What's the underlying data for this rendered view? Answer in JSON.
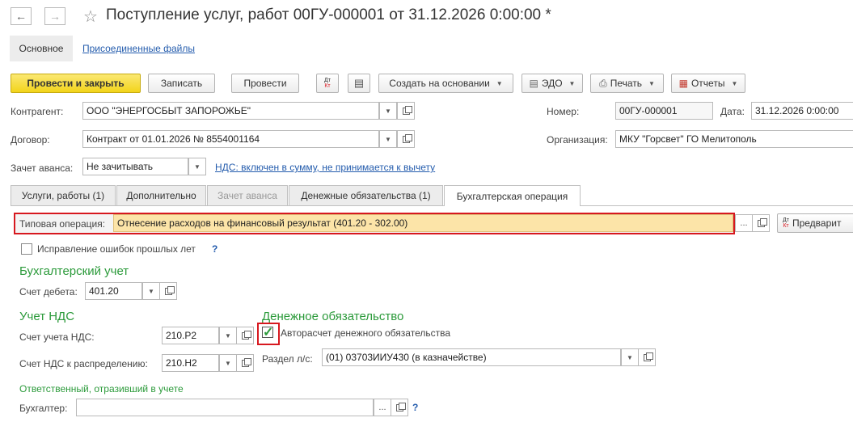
{
  "window": {
    "title": "Поступление услуг, работ 00ГУ-000001 от 31.12.2026 0:00:00 *"
  },
  "nav": {
    "back_icon": "arrow-left-icon",
    "forward_icon": "arrow-right-icon",
    "favorite_icon": "star-icon"
  },
  "sections": {
    "main": "Основное",
    "files": "Присоединенные файлы"
  },
  "toolbar": {
    "post_close": "Провести и закрыть",
    "save": "Записать",
    "post": "Провести",
    "dt_kt_icon": "dt-kt-icon",
    "report_icon": "list-icon",
    "create_based": "Создать на основании",
    "edo": "ЭДО",
    "print": "Печать",
    "reports": "Отчеты"
  },
  "header": {
    "counterparty_label": "Контрагент:",
    "counterparty_value": "ООО \"ЭНЕРГОСБЫТ ЗАПОРОЖЬЕ\"",
    "contract_label": "Договор:",
    "contract_value": "Контракт от 01.01.2026 № 8554001164",
    "number_label": "Номер:",
    "number_value": "00ГУ-000001",
    "date_label": "Дата:",
    "date_value": "31.12.2026  0:00:00",
    "org_label": "Организация:",
    "org_value": "МКУ \"Горсвет\" ГО Мелитополь",
    "advance_label": "Зачет аванса:",
    "advance_value": "Не зачитывать",
    "vat_link": "НДС: включен в сумму, не принимается к вычету"
  },
  "tabs": [
    {
      "label": "Услуги, работы (1)",
      "state": "normal"
    },
    {
      "label": "Дополнительно",
      "state": "normal"
    },
    {
      "label": "Зачет аванса",
      "state": "disabled"
    },
    {
      "label": "Денежные обязательства (1)",
      "state": "normal"
    },
    {
      "label": "Бухгалтерская операция",
      "state": "active"
    }
  ],
  "operation": {
    "typical_label": "Типовая операция:",
    "typical_value": "Отнесение расходов на финансовый результат (401.20 - 302.00)",
    "preview_label": "Предварит",
    "corrections_label": "Исправление ошибок прошлых лет",
    "help": "?"
  },
  "accounting": {
    "title": "Бухгалтерский учет",
    "debit_label": "Счет дебета:",
    "debit_value": "401.20"
  },
  "vat": {
    "title": "Учет НДС",
    "account_label": "Счет учета НДС:",
    "account_value": "210.Р2",
    "distribution_label": "Счет НДС к распределению:",
    "distribution_value": "210.Н2"
  },
  "obligation": {
    "title": "Денежное обязательство",
    "auto_label": "Авторасчет денежного обязательства",
    "auto_checked": true,
    "section_label": "Раздел л/с:",
    "section_value": "(01) 03703ИИУ430 (в казначействе)"
  },
  "responsible": {
    "title": "Ответственный, отразивший в учете",
    "accountant_label": "Бухгалтер:",
    "accountant_value": "",
    "help": "?"
  },
  "colors": {
    "highlight": "#d7181f",
    "accent_green": "#2b9a3a",
    "primary_button": "#f2d41b",
    "operation_bg": "#fce4a8"
  }
}
